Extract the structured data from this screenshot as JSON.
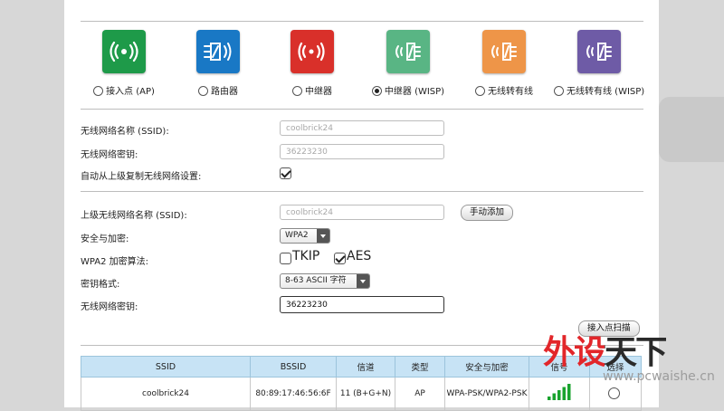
{
  "modes": [
    {
      "label": "接入点 (AP)",
      "color": "#1e9a49",
      "icon": "broadcast-icon",
      "selected": false
    },
    {
      "label": "路由器",
      "color": "#1978c5",
      "icon": "router-icon",
      "selected": false
    },
    {
      "label": "中继器",
      "color": "#d9302a",
      "icon": "repeater-icon",
      "selected": false
    },
    {
      "label": "中继器 (WISP)",
      "color": "#59b584",
      "icon": "wisp-repeater-icon",
      "selected": true
    },
    {
      "label": "无线转有线",
      "color": "#ee9548",
      "icon": "wireless-to-wired-icon",
      "selected": false
    },
    {
      "label": "无线转有线 (WISP)",
      "color": "#6e5ba6",
      "icon": "wisp-wireless-to-wired-icon",
      "selected": false
    }
  ],
  "local": {
    "ssid_label": "无线网络名称 (SSID):",
    "ssid_value": "coolbrick24",
    "key_label": "无线网络密钥:",
    "key_value": "36223230",
    "copy_label": "自动从上级复制无线网络设置:",
    "copy_checked": true
  },
  "upstream": {
    "ssid_label": "上级无线网络名称 (SSID):",
    "ssid_value": "coolbrick24",
    "manual_add": "手动添加",
    "security_label": "安全与加密:",
    "security_value": "WPA2",
    "algo_label": "WPA2 加密算法:",
    "tkip": "TKIP",
    "aes": "AES",
    "format_label": "密钥格式:",
    "format_value": "8-63 ASCII 字符",
    "key_label": "无线网络密钥:",
    "key_value": "36223230",
    "scan_button": "接入点扫描"
  },
  "table": {
    "headers": [
      "SSID",
      "BSSID",
      "信道",
      "类型",
      "安全与加密",
      "信号",
      "选择"
    ],
    "rows": [
      {
        "ssid": "coolbrick24",
        "bssid": "80:89:17:46:56:6F",
        "channel": "11 (B+G+N)",
        "type": "AP",
        "security": "WPA-PSK/WPA2-PSK",
        "signal_bars": 5
      }
    ]
  },
  "watermark": {
    "brand": "外设天下",
    "url": "www.pcwaishe.cn"
  },
  "colors": {
    "header_bg": "#c7e3f5",
    "signal": "#19a32e"
  }
}
